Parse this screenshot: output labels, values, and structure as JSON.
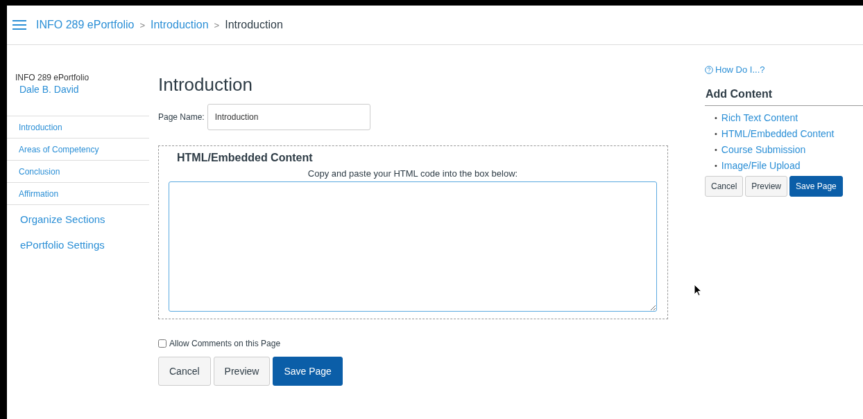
{
  "breadcrumbs": [
    {
      "label": "INFO 289 ePortfolio",
      "link": true
    },
    {
      "label": "Introduction",
      "link": true
    },
    {
      "label": "Introduction",
      "link": false
    }
  ],
  "breadcrumb_separator": ">",
  "sidebar": {
    "portfolio": "INFO 289 ePortfolio",
    "owner": "Dale B. David",
    "sections": [
      "Introduction",
      "Areas of Competency",
      "Conclusion",
      "Affirmation"
    ],
    "links": [
      "Organize Sections",
      "ePortfolio Settings"
    ]
  },
  "main": {
    "title": "Introduction",
    "page_name_label": "Page Name:",
    "page_name_value": "Introduction",
    "block": {
      "title": "HTML/Embedded Content",
      "instruction": "Copy and paste your HTML code into the box below:"
    },
    "allow_comments": {
      "label": "Allow Comments on this Page",
      "checked": false
    },
    "buttons": [
      {
        "label": "Cancel",
        "kind": "default"
      },
      {
        "label": "Preview",
        "kind": "default"
      },
      {
        "label": "Save Page",
        "kind": "primary"
      }
    ]
  },
  "aside": {
    "help": "How Do I...?",
    "heading": "Add Content",
    "bullet": "•",
    "items": [
      "Rich Text Content",
      "HTML/Embedded Content",
      "Course Submission",
      "Image/File Upload"
    ],
    "buttons": [
      {
        "label": "Cancel",
        "kind": "default"
      },
      {
        "label": "Preview",
        "kind": "default"
      },
      {
        "label": "Save Page",
        "kind": "primary"
      }
    ]
  }
}
